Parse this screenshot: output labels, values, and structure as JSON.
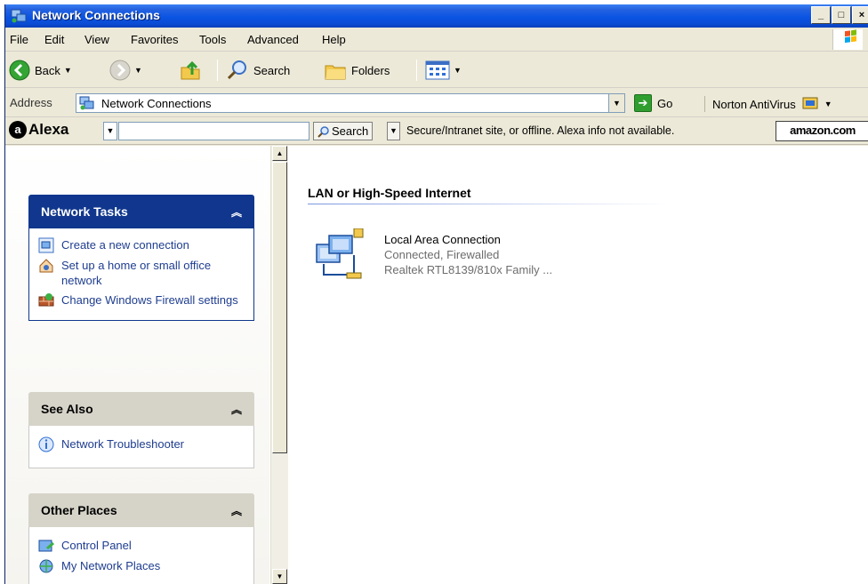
{
  "window": {
    "title": "Network Connections",
    "buttons": {
      "minimize": "_",
      "maximize": "□",
      "close": "×"
    }
  },
  "menu": [
    "File",
    "Edit",
    "View",
    "Favorites",
    "Tools",
    "Advanced",
    "Help"
  ],
  "toolbar": {
    "back_label": "Back",
    "search_label": "Search",
    "folders_label": "Folders"
  },
  "address": {
    "label": "Address",
    "value": "Network Connections",
    "go_label": "Go",
    "norton_label": "Norton AntiVirus"
  },
  "alexa": {
    "brand": "Alexa",
    "input_value": "",
    "search_label": "Search",
    "status_text": "Secure/Intranet site, or offline. Alexa info not available.",
    "amazon_label": "amazon.com"
  },
  "sidebar": {
    "network_tasks": {
      "title": "Network Tasks",
      "items": [
        {
          "label": "Create a new connection",
          "icon": "new-connection-icon"
        },
        {
          "label": "Set up a home or small office network",
          "icon": "home-network-icon"
        },
        {
          "label": "Change Windows Firewall settings",
          "icon": "firewall-icon"
        }
      ]
    },
    "see_also": {
      "title": "See Also",
      "items": [
        {
          "label": "Network Troubleshooter",
          "icon": "info-icon"
        }
      ]
    },
    "other_places": {
      "title": "Other Places",
      "items": [
        {
          "label": "Control Panel",
          "icon": "control-panel-icon"
        },
        {
          "label": "My Network Places",
          "icon": "network-places-icon"
        }
      ]
    }
  },
  "main": {
    "group_title": "LAN or High-Speed Internet",
    "connection": {
      "name": "Local Area Connection",
      "status": "Connected, Firewalled",
      "device": "Realtek RTL8139/810x Family ..."
    }
  },
  "colors": {
    "title_bar": "#0a54e3",
    "task_pane_header": "#10378d",
    "group_line": "#7a96df",
    "window_bg": "#ece9d8"
  }
}
